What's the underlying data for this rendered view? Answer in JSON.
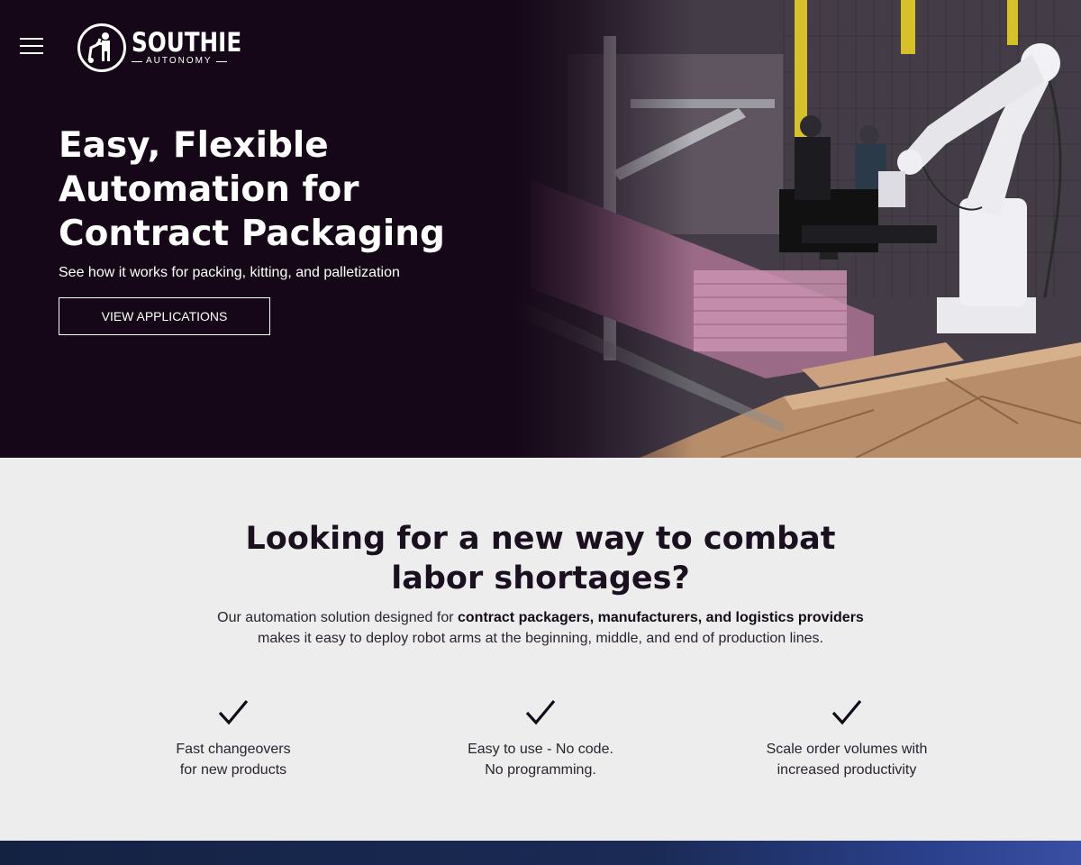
{
  "brand": {
    "name": "SOUTHIE",
    "tagline": "AUTONOMY"
  },
  "hero": {
    "title_lines": [
      "Easy, Flexible",
      "Automation for",
      "Contract Packaging"
    ],
    "subtitle": "See how it works for packing, kitting, and palletization",
    "cta_label": "VIEW APPLICATIONS"
  },
  "section": {
    "heading_lines": [
      "Looking for a new way to combat",
      "labor shortages?"
    ],
    "intro_prefix": "Our automation solution designed for ",
    "intro_bold": "contract packagers, manufacturers, and logistics providers",
    "intro_suffix": "makes it easy to deploy robot arms at the beginning, middle, and end of production lines."
  },
  "features": [
    {
      "line1": "Fast changeovers",
      "line2": "for new products",
      "icon": "checkmark-icon"
    },
    {
      "line1": "Easy to use - No code.",
      "line2": "No programming.",
      "icon": "checkmark-icon"
    },
    {
      "line1": "Scale order volumes with",
      "line2": "increased productivity",
      "icon": "checkmark-icon"
    }
  ],
  "colors": {
    "hero_bg": "#150717",
    "section_bg": "#ededed",
    "text_dark": "#1a1020",
    "footer_band": "#1a2a55"
  }
}
